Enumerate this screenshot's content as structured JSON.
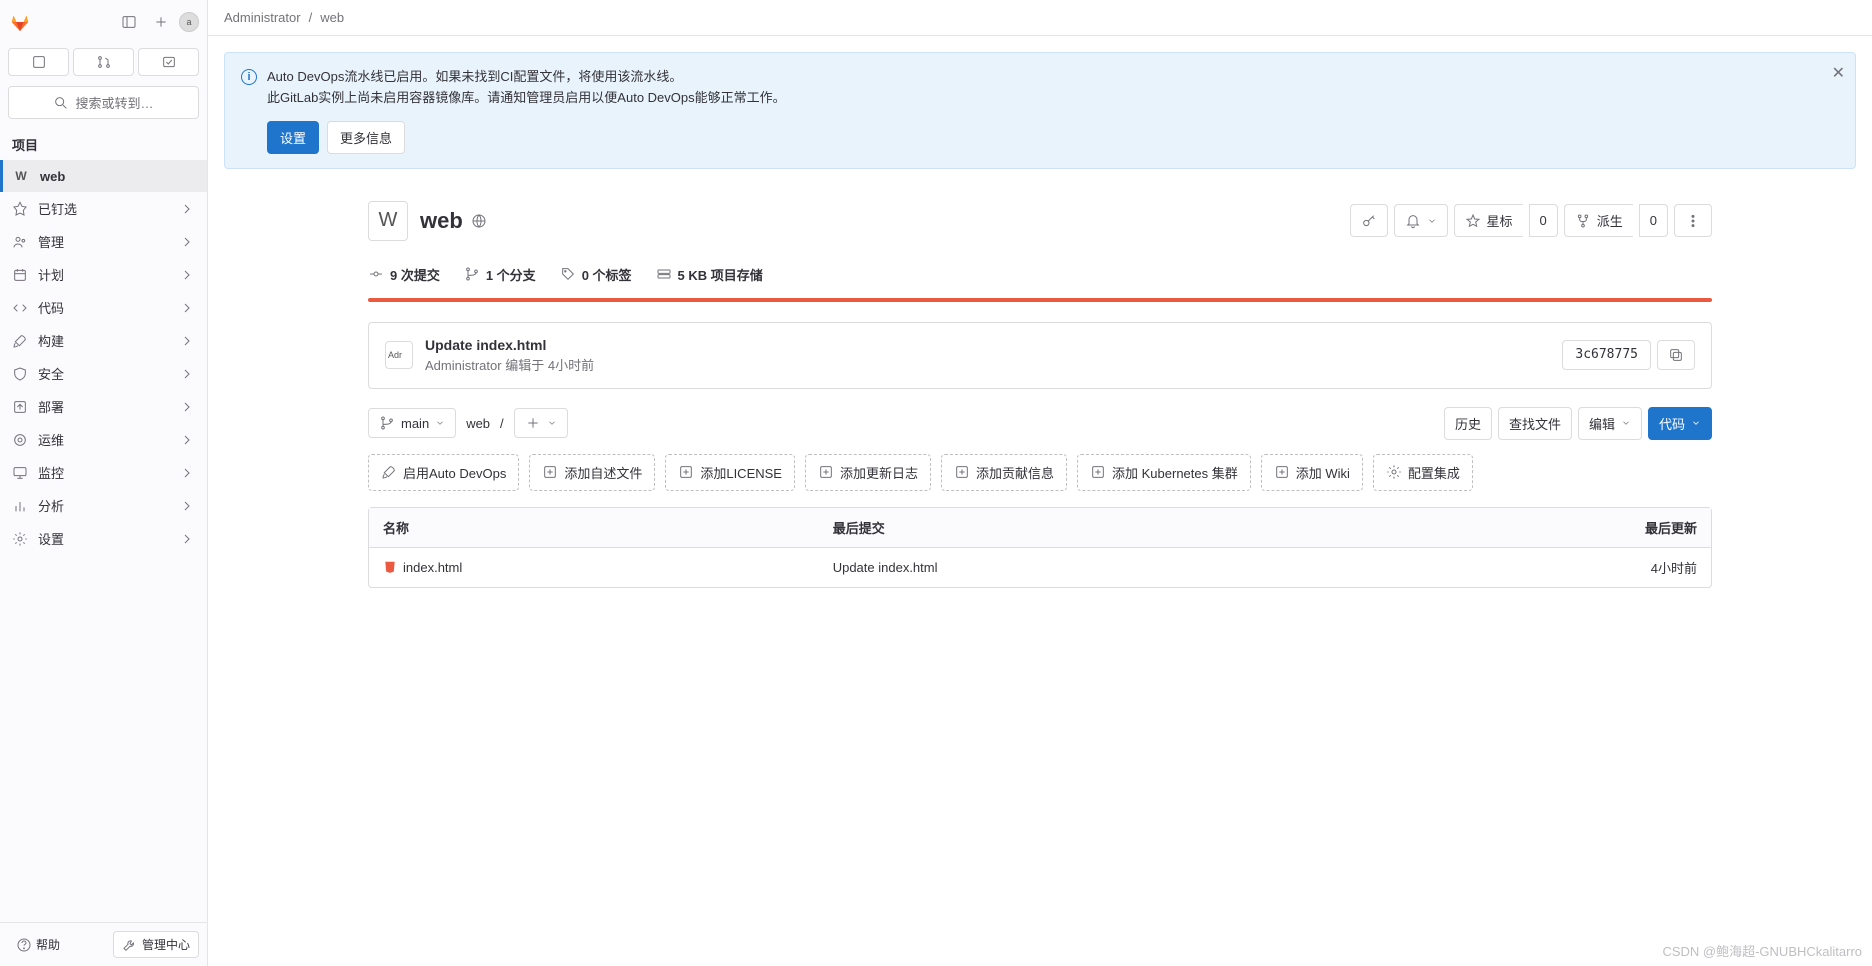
{
  "sidebar": {
    "search_placeholder": "搜索或转到…",
    "avatar_label": "a",
    "section_label": "项目",
    "project_letter": "W",
    "project_name": "web",
    "items": [
      {
        "label": "已钉选"
      },
      {
        "label": "管理"
      },
      {
        "label": "计划"
      },
      {
        "label": "代码"
      },
      {
        "label": "构建"
      },
      {
        "label": "安全"
      },
      {
        "label": "部署"
      },
      {
        "label": "运维"
      },
      {
        "label": "监控"
      },
      {
        "label": "分析"
      },
      {
        "label": "设置"
      }
    ],
    "help_label": "帮助",
    "admin_center_label": "管理中心"
  },
  "breadcrumb": {
    "owner": "Administrator",
    "project": "web"
  },
  "alert": {
    "line1": "Auto DevOps流水线已启用。如果未找到CI配置文件，将使用该流水线。",
    "line2": "此GitLab实例上尚未启用容器镜像库。请通知管理员启用以便Auto DevOps能够正常工作。",
    "btn_settings": "设置",
    "btn_more": "更多信息"
  },
  "project": {
    "avatar_letter": "W",
    "name": "web"
  },
  "actions": {
    "star_label": "星标",
    "star_count": "0",
    "fork_label": "派生",
    "fork_count": "0"
  },
  "stats": {
    "commits": "9 次提交",
    "branches": "1 个分支",
    "tags": "0 个标签",
    "storage": "5 KB 项目存储"
  },
  "commit": {
    "title": "Update index.html",
    "author": "Administrator",
    "authored_label": "编辑于",
    "time": "4小时前",
    "sha": "3c678775"
  },
  "toolbar": {
    "branch": "main",
    "path": "web",
    "history": "历史",
    "find_file": "查找文件",
    "edit": "编辑",
    "code": "代码"
  },
  "suggest": [
    {
      "label": "启用Auto DevOps"
    },
    {
      "label": "添加自述文件"
    },
    {
      "label": "添加LICENSE"
    },
    {
      "label": "添加更新日志"
    },
    {
      "label": "添加贡献信息"
    },
    {
      "label": "添加 Kubernetes 集群"
    },
    {
      "label": "添加 Wiki"
    },
    {
      "label": "配置集成"
    }
  ],
  "table": {
    "col_name": "名称",
    "col_commit": "最后提交",
    "col_updated": "最后更新",
    "rows": [
      {
        "name": "index.html",
        "commit": "Update index.html",
        "updated": "4小时前"
      }
    ]
  },
  "watermark": "CSDN @鲍海超-GNUBHCkalitarro"
}
